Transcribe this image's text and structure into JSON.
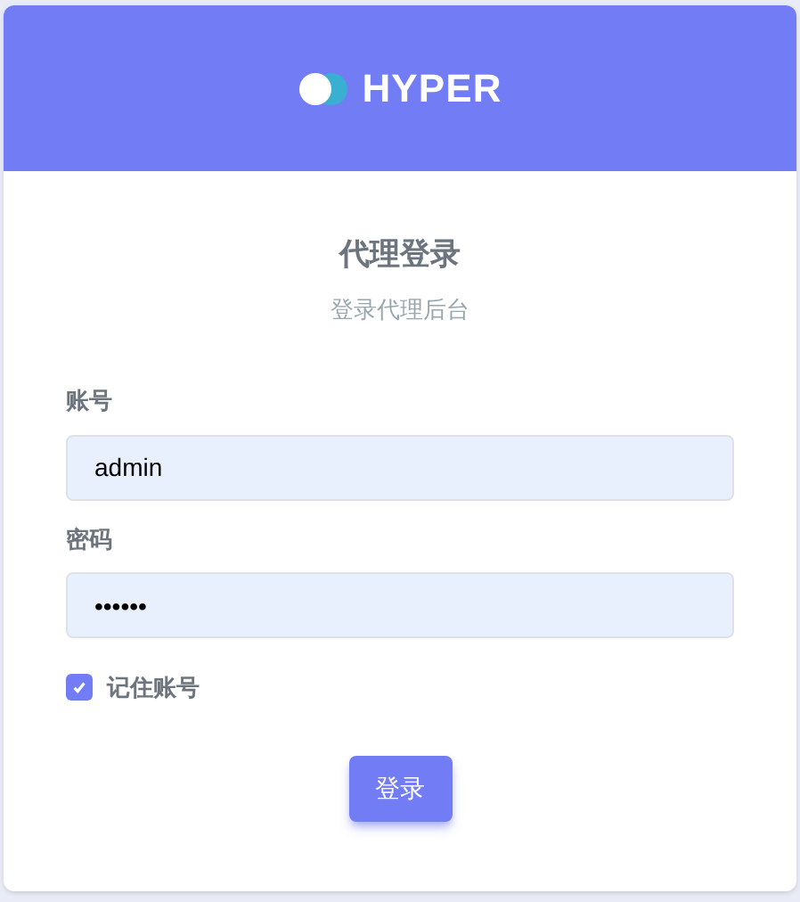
{
  "logo": {
    "text": "HYPER"
  },
  "title": "代理登录",
  "subtitle": "登录代理后台",
  "fields": [
    {
      "label": "账号",
      "value": "admin"
    },
    {
      "label": "密码",
      "value": "••••••"
    }
  ],
  "remember": {
    "label": "记住账号",
    "checked": true
  },
  "submit": "登录"
}
